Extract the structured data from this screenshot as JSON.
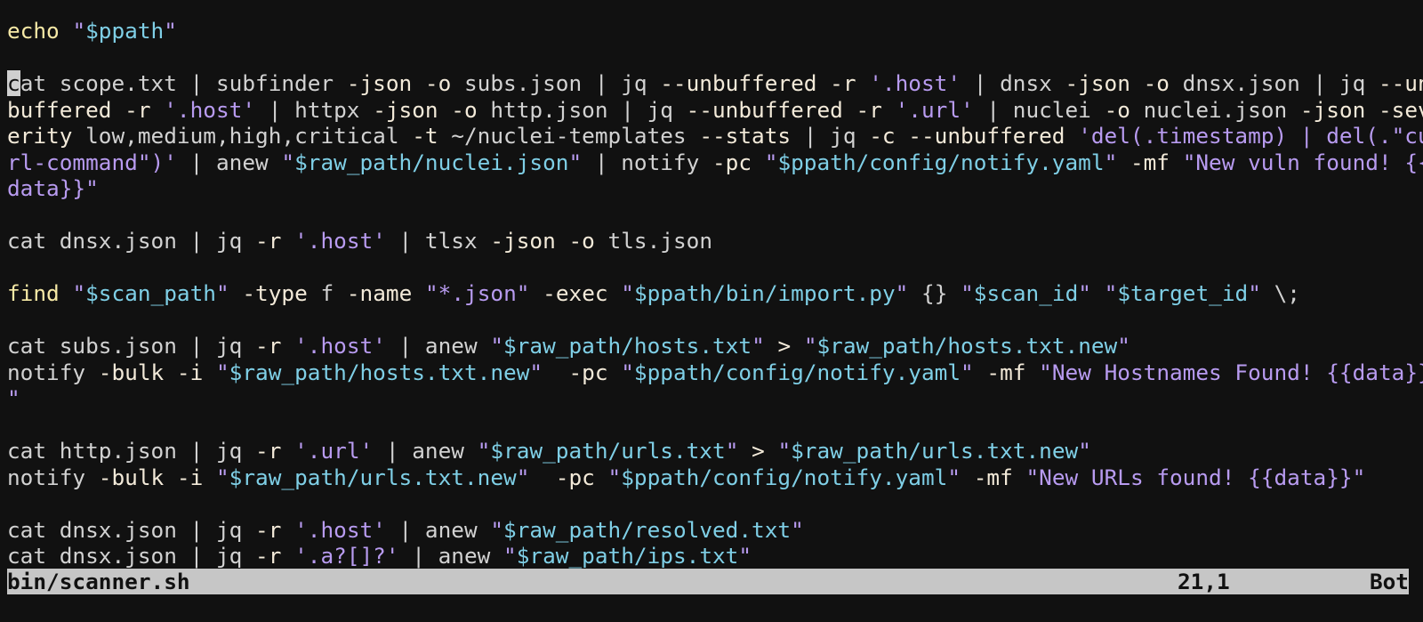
{
  "colors": {
    "background": "#111111",
    "command": "#f6e9a6",
    "text": "#d2d2d2",
    "flag": "#f3ead9",
    "variable": "#7fcfe6",
    "string": "#b89bf0",
    "statusline_bg": "#c6c6c6"
  },
  "buffer": {
    "lines": [
      [
        {
          "t": "cmd",
          "s": "echo "
        },
        {
          "t": "str",
          "s": "\""
        },
        {
          "t": "var",
          "s": "$ppath"
        },
        {
          "t": "str",
          "s": "\""
        }
      ],
      [],
      [
        {
          "t": "cursor",
          "s": "c"
        },
        {
          "t": "text",
          "s": "at scope.txt | subfinder "
        },
        {
          "t": "flag",
          "s": "-json -o"
        },
        {
          "t": "text",
          "s": " subs.json | jq "
        },
        {
          "t": "flag",
          "s": "--unbuffered -r"
        },
        {
          "t": "text",
          "s": " "
        },
        {
          "t": "str",
          "s": "'.host'"
        },
        {
          "t": "text",
          "s": " | dnsx "
        },
        {
          "t": "flag",
          "s": "-json -o"
        },
        {
          "t": "text",
          "s": " dnsx.json | jq "
        },
        {
          "t": "flag",
          "s": "--un"
        }
      ],
      [
        {
          "t": "flag",
          "s": "buffered -r"
        },
        {
          "t": "text",
          "s": " "
        },
        {
          "t": "str",
          "s": "'.host'"
        },
        {
          "t": "text",
          "s": " | httpx "
        },
        {
          "t": "flag",
          "s": "-json -o"
        },
        {
          "t": "text",
          "s": " http.json | jq "
        },
        {
          "t": "flag",
          "s": "--unbuffered -r"
        },
        {
          "t": "text",
          "s": " "
        },
        {
          "t": "str",
          "s": "'.url'"
        },
        {
          "t": "text",
          "s": " | nuclei "
        },
        {
          "t": "flag",
          "s": "-o"
        },
        {
          "t": "text",
          "s": " nuclei.json "
        },
        {
          "t": "flag",
          "s": "-json -sev"
        }
      ],
      [
        {
          "t": "flag",
          "s": "erity"
        },
        {
          "t": "text",
          "s": " low,medium,high,critical "
        },
        {
          "t": "flag",
          "s": "-t"
        },
        {
          "t": "text",
          "s": " ~/nuclei-templates "
        },
        {
          "t": "flag",
          "s": "--stats"
        },
        {
          "t": "text",
          "s": " | jq "
        },
        {
          "t": "flag",
          "s": "-c --unbuffered"
        },
        {
          "t": "text",
          "s": " "
        },
        {
          "t": "str",
          "s": "'del(.timestamp) | del(.\"cu"
        }
      ],
      [
        {
          "t": "str",
          "s": "rl-command\")'"
        },
        {
          "t": "text",
          "s": " | anew "
        },
        {
          "t": "str",
          "s": "\""
        },
        {
          "t": "var",
          "s": "$raw_path/nuclei.json"
        },
        {
          "t": "str",
          "s": "\""
        },
        {
          "t": "text",
          "s": " | notify "
        },
        {
          "t": "flag",
          "s": "-pc"
        },
        {
          "t": "text",
          "s": " "
        },
        {
          "t": "str",
          "s": "\""
        },
        {
          "t": "var",
          "s": "$ppath/config/notify.yaml"
        },
        {
          "t": "str",
          "s": "\""
        },
        {
          "t": "text",
          "s": " "
        },
        {
          "t": "flag",
          "s": "-mf"
        },
        {
          "t": "text",
          "s": " "
        },
        {
          "t": "str",
          "s": "\"New vuln found! {{"
        }
      ],
      [
        {
          "t": "str",
          "s": "data}}\""
        }
      ],
      [],
      [
        {
          "t": "text",
          "s": "cat dnsx.json | jq "
        },
        {
          "t": "flag",
          "s": "-r"
        },
        {
          "t": "text",
          "s": " "
        },
        {
          "t": "str",
          "s": "'.host'"
        },
        {
          "t": "text",
          "s": " | tlsx "
        },
        {
          "t": "flag",
          "s": "-json -o"
        },
        {
          "t": "text",
          "s": " tls.json"
        }
      ],
      [],
      [
        {
          "t": "cmd",
          "s": "find"
        },
        {
          "t": "text",
          "s": " "
        },
        {
          "t": "str",
          "s": "\""
        },
        {
          "t": "var",
          "s": "$scan_path"
        },
        {
          "t": "str",
          "s": "\""
        },
        {
          "t": "text",
          "s": " "
        },
        {
          "t": "flag",
          "s": "-type"
        },
        {
          "t": "text",
          "s": " f "
        },
        {
          "t": "flag",
          "s": "-name"
        },
        {
          "t": "text",
          "s": " "
        },
        {
          "t": "str",
          "s": "\"*.json\""
        },
        {
          "t": "text",
          "s": " "
        },
        {
          "t": "flag",
          "s": "-exec"
        },
        {
          "t": "text",
          "s": " "
        },
        {
          "t": "str",
          "s": "\""
        },
        {
          "t": "var",
          "s": "$ppath/bin/import.py"
        },
        {
          "t": "str",
          "s": "\""
        },
        {
          "t": "text",
          "s": " {} "
        },
        {
          "t": "str",
          "s": "\""
        },
        {
          "t": "var",
          "s": "$scan_id"
        },
        {
          "t": "str",
          "s": "\""
        },
        {
          "t": "text",
          "s": " "
        },
        {
          "t": "str",
          "s": "\""
        },
        {
          "t": "var",
          "s": "$target_id"
        },
        {
          "t": "str",
          "s": "\""
        },
        {
          "t": "text",
          "s": " \\;"
        }
      ],
      [],
      [
        {
          "t": "text",
          "s": "cat subs.json | jq "
        },
        {
          "t": "flag",
          "s": "-r"
        },
        {
          "t": "text",
          "s": " "
        },
        {
          "t": "str",
          "s": "'.host'"
        },
        {
          "t": "text",
          "s": " | anew "
        },
        {
          "t": "str",
          "s": "\""
        },
        {
          "t": "var",
          "s": "$raw_path/hosts.txt"
        },
        {
          "t": "str",
          "s": "\""
        },
        {
          "t": "text",
          "s": " "
        },
        {
          "t": "flag",
          "s": ">"
        },
        {
          "t": "text",
          "s": " "
        },
        {
          "t": "str",
          "s": "\""
        },
        {
          "t": "var",
          "s": "$raw_path/hosts.txt.new"
        },
        {
          "t": "str",
          "s": "\""
        }
      ],
      [
        {
          "t": "text",
          "s": "notify "
        },
        {
          "t": "flag",
          "s": "-bulk -i"
        },
        {
          "t": "text",
          "s": " "
        },
        {
          "t": "str",
          "s": "\""
        },
        {
          "t": "var",
          "s": "$raw_path/hosts.txt.new"
        },
        {
          "t": "str",
          "s": "\""
        },
        {
          "t": "text",
          "s": "  "
        },
        {
          "t": "flag",
          "s": "-pc"
        },
        {
          "t": "text",
          "s": " "
        },
        {
          "t": "str",
          "s": "\""
        },
        {
          "t": "var",
          "s": "$ppath/config/notify.yaml"
        },
        {
          "t": "str",
          "s": "\""
        },
        {
          "t": "text",
          "s": " "
        },
        {
          "t": "flag",
          "s": "-mf"
        },
        {
          "t": "text",
          "s": " "
        },
        {
          "t": "str",
          "s": "\"New Hostnames Found! {{data}}"
        }
      ],
      [
        {
          "t": "str",
          "s": "\""
        }
      ],
      [],
      [
        {
          "t": "text",
          "s": "cat http.json | jq "
        },
        {
          "t": "flag",
          "s": "-r"
        },
        {
          "t": "text",
          "s": " "
        },
        {
          "t": "str",
          "s": "'.url'"
        },
        {
          "t": "text",
          "s": " | anew "
        },
        {
          "t": "str",
          "s": "\""
        },
        {
          "t": "var",
          "s": "$raw_path/urls.txt"
        },
        {
          "t": "str",
          "s": "\""
        },
        {
          "t": "text",
          "s": " "
        },
        {
          "t": "flag",
          "s": ">"
        },
        {
          "t": "text",
          "s": " "
        },
        {
          "t": "str",
          "s": "\""
        },
        {
          "t": "var",
          "s": "$raw_path/urls.txt.new"
        },
        {
          "t": "str",
          "s": "\""
        }
      ],
      [
        {
          "t": "text",
          "s": "notify "
        },
        {
          "t": "flag",
          "s": "-bulk -i"
        },
        {
          "t": "text",
          "s": " "
        },
        {
          "t": "str",
          "s": "\""
        },
        {
          "t": "var",
          "s": "$raw_path/urls.txt.new"
        },
        {
          "t": "str",
          "s": "\""
        },
        {
          "t": "text",
          "s": "  "
        },
        {
          "t": "flag",
          "s": "-pc"
        },
        {
          "t": "text",
          "s": " "
        },
        {
          "t": "str",
          "s": "\""
        },
        {
          "t": "var",
          "s": "$ppath/config/notify.yaml"
        },
        {
          "t": "str",
          "s": "\""
        },
        {
          "t": "text",
          "s": " "
        },
        {
          "t": "flag",
          "s": "-mf"
        },
        {
          "t": "text",
          "s": " "
        },
        {
          "t": "str",
          "s": "\"New URLs found! {{data}}\""
        }
      ],
      [],
      [
        {
          "t": "text",
          "s": "cat dnsx.json | jq "
        },
        {
          "t": "flag",
          "s": "-r"
        },
        {
          "t": "text",
          "s": " "
        },
        {
          "t": "str",
          "s": "'.host'"
        },
        {
          "t": "text",
          "s": " | anew "
        },
        {
          "t": "str",
          "s": "\""
        },
        {
          "t": "var",
          "s": "$raw_path/resolved.txt"
        },
        {
          "t": "str",
          "s": "\""
        }
      ],
      [
        {
          "t": "text",
          "s": "cat dnsx.json | jq "
        },
        {
          "t": "flag",
          "s": "-r"
        },
        {
          "t": "text",
          "s": " "
        },
        {
          "t": "str",
          "s": "'.a?[]?'"
        },
        {
          "t": "text",
          "s": " | anew "
        },
        {
          "t": "str",
          "s": "\""
        },
        {
          "t": "var",
          "s": "$raw_path/ips.txt"
        },
        {
          "t": "str",
          "s": "\""
        }
      ]
    ]
  },
  "statusline": {
    "filename": "bin/scanner.sh",
    "position": "21,1",
    "scroll": "Bot"
  }
}
